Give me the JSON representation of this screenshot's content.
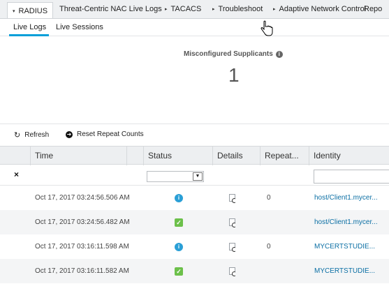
{
  "topnav": {
    "tabs": [
      {
        "label": "RADIUS",
        "caret": "▾",
        "active": true
      },
      {
        "label": "Threat-Centric NAC Live Logs",
        "caret": ""
      },
      {
        "label": "TACACS",
        "caret": "▸"
      },
      {
        "label": "Troubleshoot",
        "caret": "▸"
      },
      {
        "label": "Adaptive Network Control",
        "caret": "▸"
      },
      {
        "label": "Repo",
        "caret": ""
      }
    ]
  },
  "subnav": {
    "tabs": [
      {
        "label": "Live Logs",
        "active": true
      },
      {
        "label": "Live Sessions"
      }
    ]
  },
  "summary": {
    "title": "Misconfigured Supplicants",
    "value": "1"
  },
  "toolbar": {
    "refresh_label": "Refresh",
    "reset_label": "Reset Repeat Counts"
  },
  "table": {
    "columns": [
      "Time",
      "Status",
      "Details",
      "Repeat...",
      "Identity"
    ],
    "rows": [
      {
        "time": "Oct 17, 2017 03:24:56.506 AM",
        "status": "info",
        "repeat": "0",
        "identity": "host/Client1.mycer..."
      },
      {
        "time": "Oct 17, 2017 03:24:56.482 AM",
        "status": "ok",
        "repeat": "",
        "identity": "host/Client1.mycer..."
      },
      {
        "time": "Oct 17, 2017 03:16:11.598 AM",
        "status": "info",
        "repeat": "0",
        "identity": "MYCERTSTUDIE..."
      },
      {
        "time": "Oct 17, 2017 03:16:11.582 AM",
        "status": "ok",
        "repeat": "",
        "identity": "MYCERTSTUDIE..."
      }
    ]
  }
}
